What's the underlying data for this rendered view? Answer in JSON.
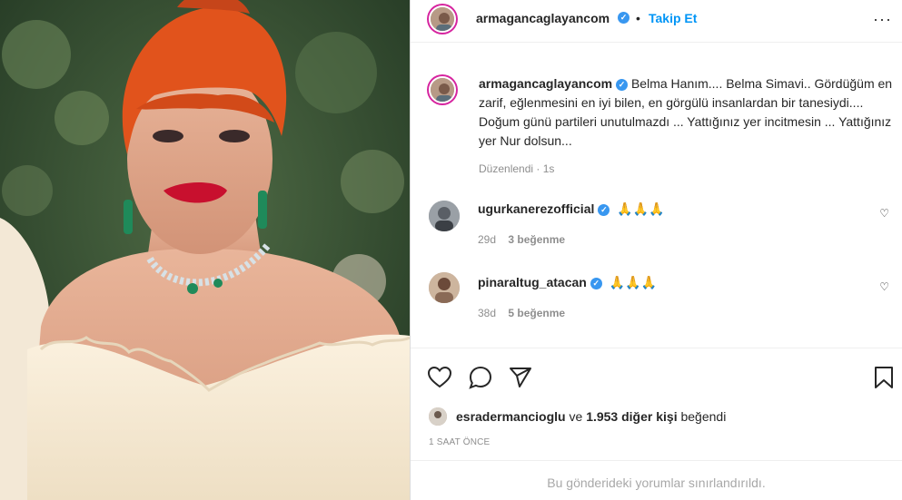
{
  "post": {
    "username": "armagancaglayancom",
    "follow_label": "Takip Et",
    "dot": "•",
    "more_icon": "more-icon"
  },
  "caption": {
    "username": "armagancaglayancom",
    "text": "Belma Hanım.... Belma Simavi.. Gördüğüm en zarif, eğlenmesini en iyi bilen, en görgülü insanlardan bir tanesiydi.... Doğum günü partileri unutulmazdı ... Yattığınız yer incitmesin ... Yattığınız yer Nur dolsun...",
    "meta": "Düzenlendi · 1s"
  },
  "comments": [
    {
      "username": "ugurkanerezofficial",
      "text": "🙏🙏🙏",
      "time": "29d",
      "likes": "3 beğenme"
    },
    {
      "username": "pinaraltug_atacan",
      "text": "🙏🙏🙏",
      "time": "38d",
      "likes": "5 beğenme"
    }
  ],
  "likes": {
    "liker": "esradermancioglu",
    "connector": "ve",
    "others": "1.953 diğer kişi",
    "suffix": "beğendi"
  },
  "timestamp": "1 SAAT ÖNCE",
  "footer": "Bu gönderideki yorumlar sınırlandırıldı.",
  "colors": {
    "accent": "#0095f6",
    "verified": "#3897f0",
    "hair": "#e1531c",
    "lips": "#c8102e"
  }
}
